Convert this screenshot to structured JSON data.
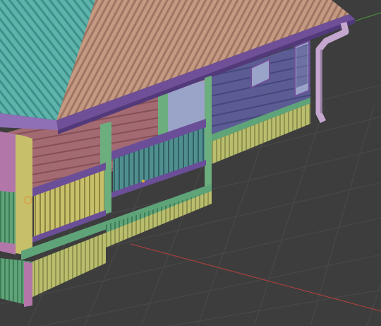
{
  "viewport": {
    "background": "#3d3d3d",
    "grid_color": "#4a4a4a",
    "x_axis_color": "#a4403f",
    "y_axis_color": "#4b8a3e"
  },
  "model": {
    "colors": {
      "roof_left": "#5eb4ac",
      "roof_right": "#c49a82",
      "fascia": "#6f4f98",
      "wall_planks": "#5b5c93",
      "porch_planks": "#a36a72",
      "post_green": "#6cae7e",
      "post_yellow": "#c8bf6b",
      "post_pink": "#b277a8",
      "skirt_yellow": "#b9bd6d",
      "skirt_green": "#5fa479",
      "railing_purple": "#6a4e98",
      "railing_balusters": "#4f8f8f",
      "window_glass": "#9aa3c8",
      "gutter_pipe": "#c5a7cf"
    }
  }
}
